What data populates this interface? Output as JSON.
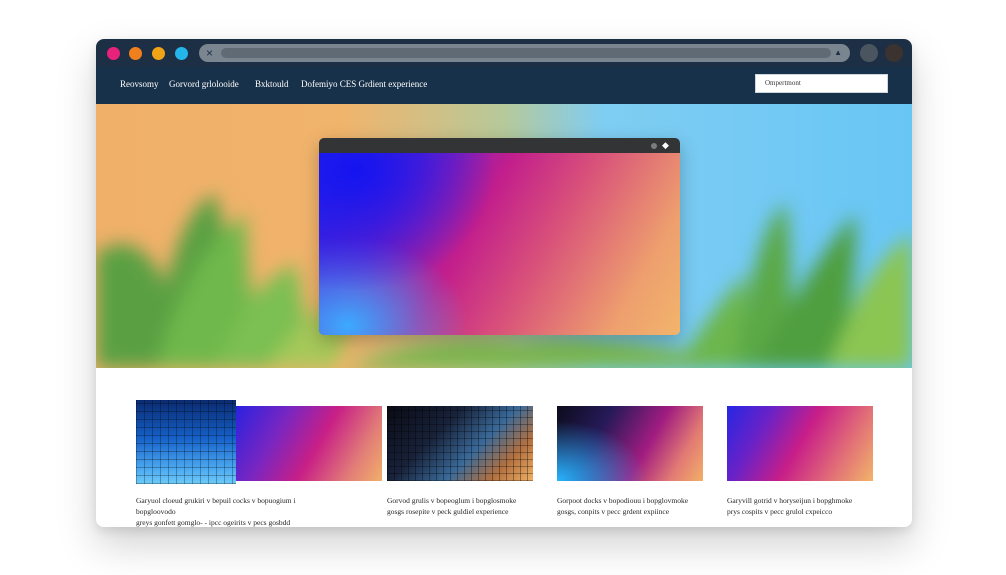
{
  "titlebar": {
    "dots": [
      "#e8217a",
      "#f07f1e",
      "#f2a417",
      "#24b6ea"
    ],
    "address_close": "×",
    "address_right": "▲"
  },
  "nav": {
    "links": [
      "Reovsomy",
      "Gorvord grlolooide",
      "Bxktould",
      "Dofemiyo CES Grdient experience"
    ],
    "search_placeholder": "Ompertmont"
  },
  "thumbnails": [
    {
      "caption_line1": "Garyuol cloeud grukiri v bepuil cocks v bopuogium i bopgloovodo",
      "caption_line2": "greys gonfett gomglo- - ipcc ogeirits v pecs gosbdd cxppince"
    },
    {
      "caption_line1": "Gorvod grulis v bopeoglum i bopglosmoke",
      "caption_line2": "gosgs rosepite v peck guldiel experience"
    },
    {
      "caption_line1": "Gorpoot docks v bopodiouu i bopglovmoke",
      "caption_line2": "gosgs, conpits v pecc grdent expiince"
    },
    {
      "caption_line1": "Garyvill gotrid v horyseijun i bopghmoke",
      "caption_line2": "prys cospits v pecc grulol cxpeicco"
    }
  ]
}
